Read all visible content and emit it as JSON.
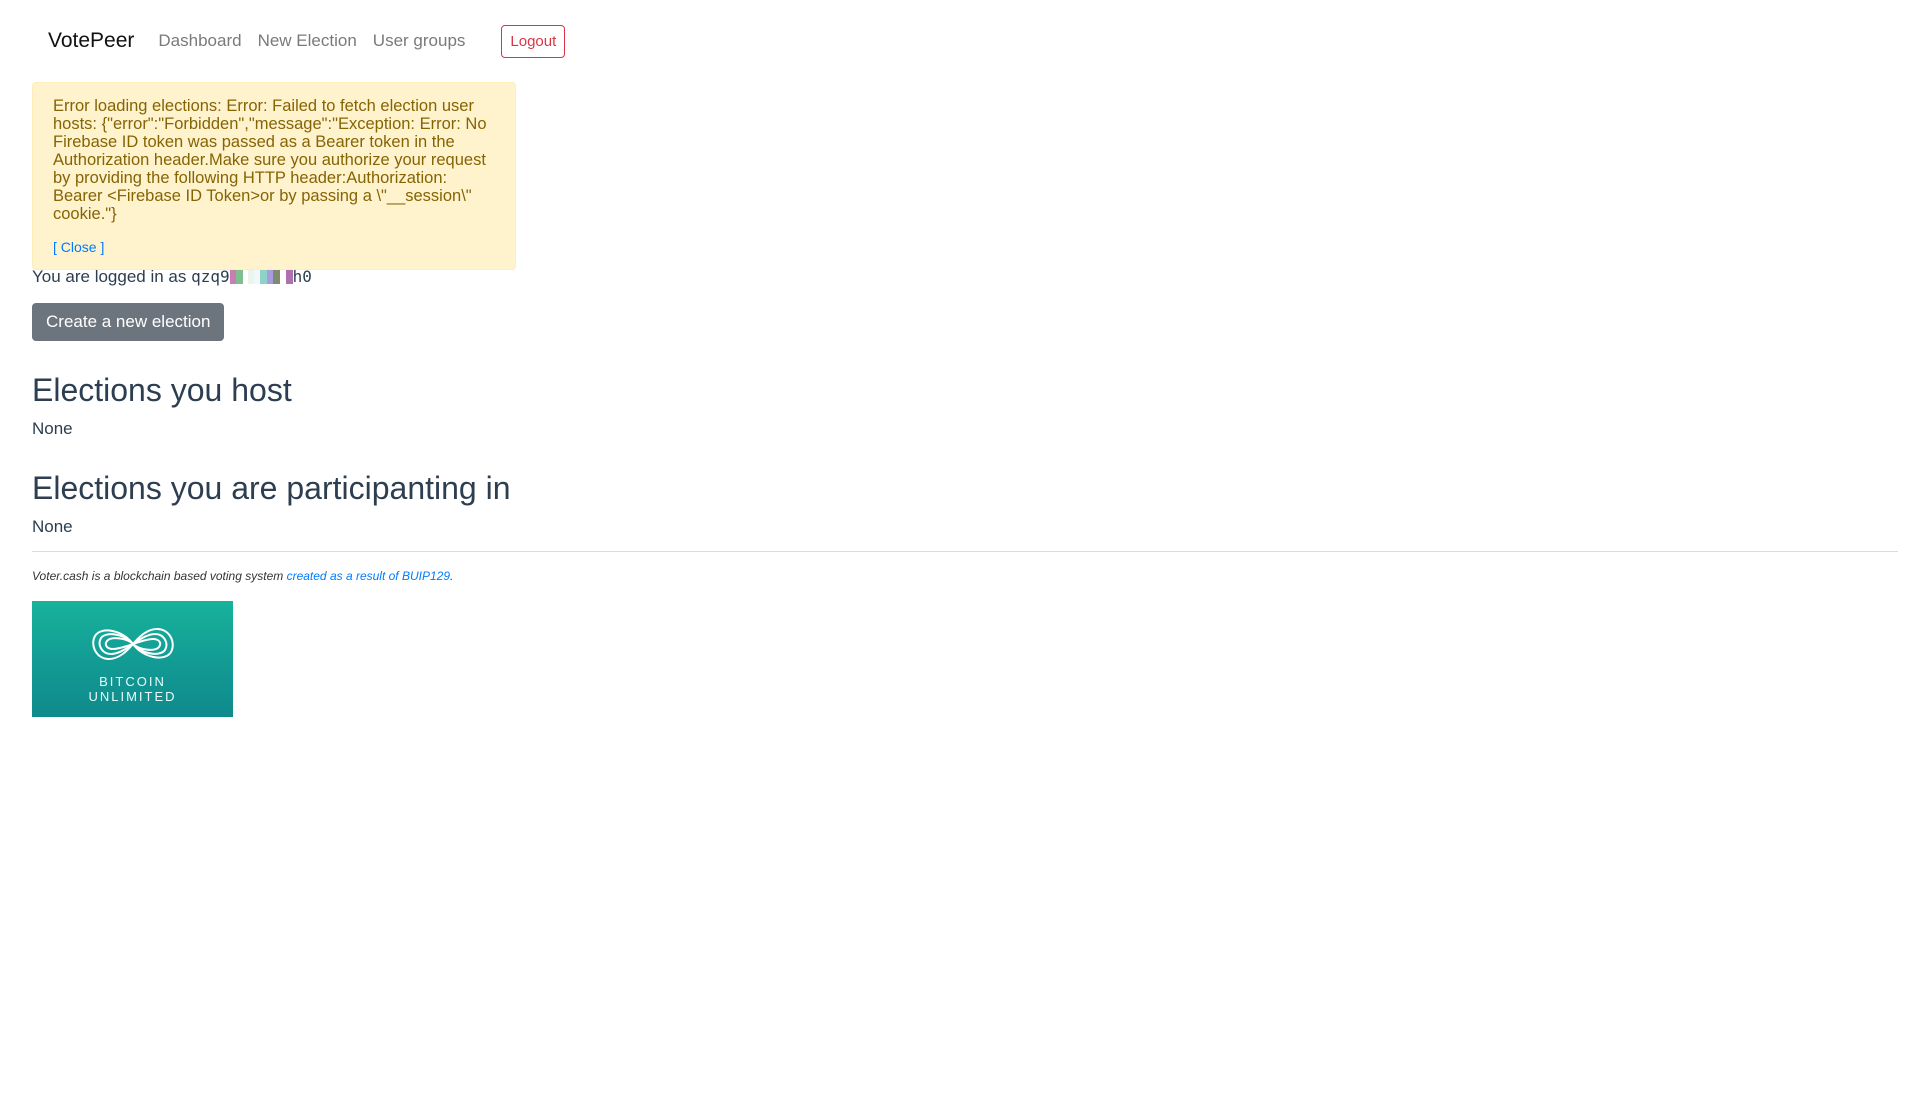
{
  "navbar": {
    "brand": "VotePeer",
    "links": [
      "Dashboard",
      "New Election",
      "User groups"
    ],
    "logout_label": "Logout"
  },
  "alert": {
    "message": "Error loading elections: Error: Failed to fetch election user hosts: {\"error\":\"Forbidden\",\"message\":\"Exception: Error: No Firebase ID token was passed as a Bearer token in the Authorization header.Make sure you authorize your request by providing the following HTTP header:Authorization: Bearer <Firebase ID Token>or by passing a \\\"__session\\\" cookie.\"}",
    "close_label": "[ Close ]"
  },
  "user": {
    "logged_in_prefix": "You are logged in as ",
    "id_start": "qzq9",
    "id_end": "h0"
  },
  "create_button_label": "Create a new election",
  "sections": {
    "host_title": "Elections you host",
    "host_empty": "None",
    "participating_title": "Elections you are participanting in",
    "participating_empty": "None"
  },
  "footer": {
    "text": "Voter.cash is a blockchain based voting system ",
    "link_text": "created as a result of BUIP129",
    "suffix": "."
  },
  "logo": {
    "line1": "BITCOIN",
    "line2": "UNLIMITED"
  },
  "colors": {
    "alert_bg": "#fff3cd",
    "alert_text": "#856404",
    "logout": "#dc3545",
    "create_btn": "#6c757d",
    "link": "#007bff",
    "logo_teal": "#129a94"
  }
}
